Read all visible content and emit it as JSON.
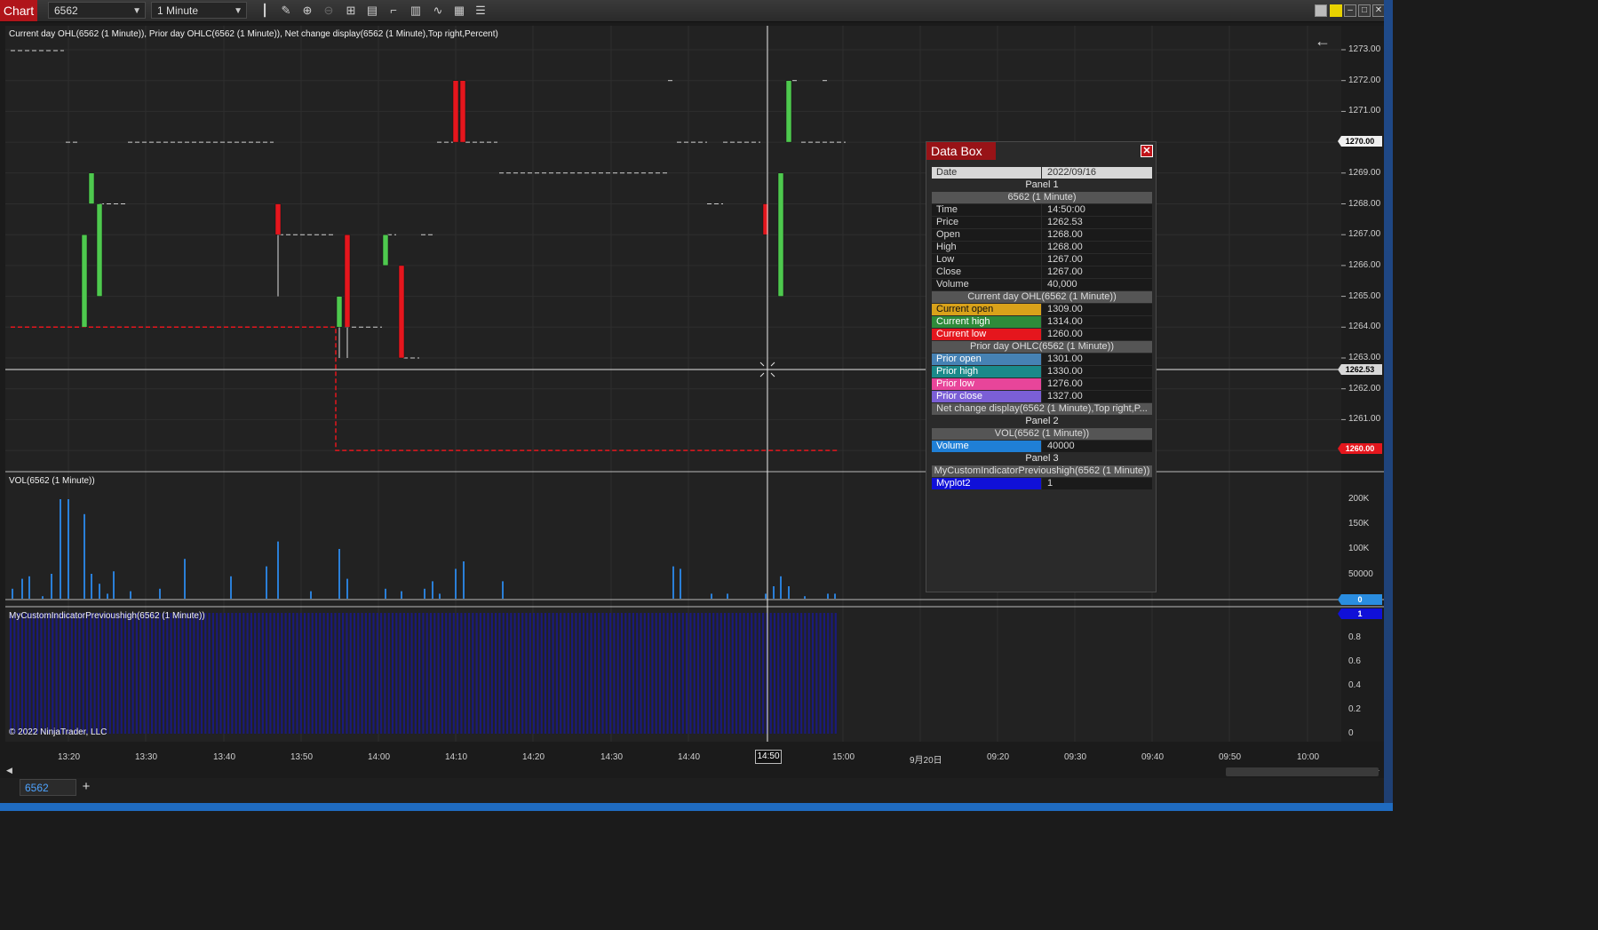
{
  "toolbar": {
    "chart_tab": "Chart",
    "instrument": "6562",
    "interval": "1 Minute",
    "icons": [
      "bar-type-icon",
      "draw-pencil-icon",
      "zoom-in-icon",
      "zoom-out-icon",
      "crosshair-icon",
      "properties-icon",
      "templates-icon",
      "strategies-icon",
      "indicators-icon",
      "data-box-icon",
      "list-icon"
    ]
  },
  "panels": {
    "price_label": "Current day OHL(6562 (1 Minute)), Prior day OHLC(6562 (1 Minute)), Net change display(6562 (1 Minute),Top right,Percent)",
    "vol_label": "VOL(6562 (1 Minute))",
    "custom_label": "MyCustomIndicatorPrevioushigh(6562 (1 Minute))",
    "copyright": "© 2022 NinjaTrader, LLC"
  },
  "price_axis": [
    "1273.00",
    "1272.00",
    "1271.00",
    "1270.00",
    "1269.00",
    "1268.00",
    "1267.00",
    "1266.00",
    "1265.00",
    "1264.00",
    "1263.00",
    "1262.00",
    "1261.00",
    "1260.00"
  ],
  "price_tags": {
    "high": "1270.00",
    "cursor": "1262.53",
    "low": "1260.00"
  },
  "vol_axis": [
    "200K",
    "150K",
    "100K",
    "50000",
    "0"
  ],
  "vol_tag": "0",
  "custom_axis": [
    "1",
    "0.8",
    "0.6",
    "0.4",
    "0.2",
    "0"
  ],
  "custom_tag": "1",
  "time_axis": [
    "13:20",
    "13:30",
    "13:40",
    "13:50",
    "14:00",
    "14:10",
    "14:20",
    "14:30",
    "14:40",
    "14:50",
    "15:00",
    "9月20日",
    "09:20",
    "09:30",
    "09:40",
    "09:50",
    "10:00"
  ],
  "cursor_time": "14:50",
  "colors": {
    "up": "#4ec94e",
    "down": "#e5161d",
    "volume": "#2a7fd8",
    "custom": "#1a1a7a",
    "ohl_line": "#e5161d"
  },
  "chart_data": {
    "type": "candlestick",
    "candles": [
      {
        "o": 1264.0,
        "h": 1267.0,
        "l": 1264.0,
        "c": 1267.0
      },
      {
        "o": 1268.0,
        "h": 1269.0,
        "l": 1268.0,
        "c": 1269.0
      },
      {
        "o": 1265.0,
        "h": 1268.0,
        "l": 1265.0,
        "c": 1268.0
      },
      {
        "o": 1268.0,
        "h": 1268.0,
        "l": 1265.0,
        "c": 1267.0
      },
      {
        "o": 1264.0,
        "h": 1265.0,
        "l": 1263.0,
        "c": 1265.0
      },
      {
        "o": 1267.0,
        "h": 1267.0,
        "l": 1263.0,
        "c": 1264.0
      },
      {
        "o": 1266.0,
        "h": 1267.0,
        "l": 1266.0,
        "c": 1267.0
      },
      {
        "o": 1266.0,
        "h": 1266.0,
        "l": 1263.0,
        "c": 1263.0
      },
      {
        "o": 1272.0,
        "h": 1272.0,
        "l": 1270.0,
        "c": 1270.0
      },
      {
        "o": 1272.0,
        "h": 1272.0,
        "l": 1270.0,
        "c": 1270.0
      },
      {
        "o": 1268.0,
        "h": 1268.0,
        "l": 1267.0,
        "c": 1267.0
      },
      {
        "o": 1265.0,
        "h": 1269.0,
        "l": 1265.0,
        "c": 1269.0
      },
      {
        "o": 1270.0,
        "h": 1272.0,
        "l": 1270.0,
        "c": 1272.0
      }
    ],
    "volumes": [
      40000,
      200000,
      170000,
      50000,
      30000,
      10000,
      15000,
      80000,
      115000,
      100000,
      40000,
      20000,
      15000,
      20000,
      35000,
      10000,
      60000,
      75000,
      35000,
      65000,
      60000,
      10000,
      10000,
      10000,
      25000,
      45000,
      25000,
      5000,
      10000,
      10000,
      20000,
      45000,
      5000,
      50000,
      200000,
      55000,
      20000,
      45000,
      65000,
      15000
    ],
    "custom_value": 1,
    "current_low": 1260.0,
    "prev_high_levels": [
      1270.0,
      1269.0,
      1268.0,
      1267.0,
      1264.0,
      1263.0
    ]
  },
  "data_box": {
    "title": "Data Box",
    "date_key": "Date",
    "date_val": "2022/09/16",
    "panel1": "Panel 1",
    "series": "6562 (1 Minute)",
    "rows": [
      {
        "k": "Time",
        "v": "14:50:00"
      },
      {
        "k": "Price",
        "v": "1262.53"
      },
      {
        "k": "Open",
        "v": "1268.00"
      },
      {
        "k": "High",
        "v": "1268.00"
      },
      {
        "k": "Low",
        "v": "1267.00"
      },
      {
        "k": "Close",
        "v": "1267.00"
      },
      {
        "k": "Volume",
        "v": "40,000"
      }
    ],
    "cur_header": "Current day OHL(6562 (1 Minute))",
    "cur_rows": [
      {
        "k": "Current open",
        "v": "1309.00",
        "c": "#d9a21a"
      },
      {
        "k": "Current high",
        "v": "1314.00",
        "c": "#2e8b3a"
      },
      {
        "k": "Current low",
        "v": "1260.00",
        "c": "#e5161d"
      }
    ],
    "prior_header": "Prior day OHLC(6562 (1 Minute))",
    "prior_rows": [
      {
        "k": "Prior open",
        "v": "1301.00",
        "c": "#4682b4"
      },
      {
        "k": "Prior high",
        "v": "1330.00",
        "c": "#1a8a8a"
      },
      {
        "k": "Prior low",
        "v": "1276.00",
        "c": "#e8459a"
      },
      {
        "k": "Prior close",
        "v": "1327.00",
        "c": "#7b5fd6"
      }
    ],
    "net_header": "Net change display(6562 (1 Minute),Top right,P...",
    "panel2": "Panel 2",
    "vol_header": "VOL(6562 (1 Minute))",
    "vol_key": "Volume",
    "vol_val": "40000",
    "panel3": "Panel 3",
    "custom_header": "MyCustomIndicatorPrevioushigh(6562 (1 Minute))",
    "myplot_key": "Myplot2",
    "myplot_val": "1"
  },
  "tabs": {
    "active": "6562",
    "add": "+"
  }
}
